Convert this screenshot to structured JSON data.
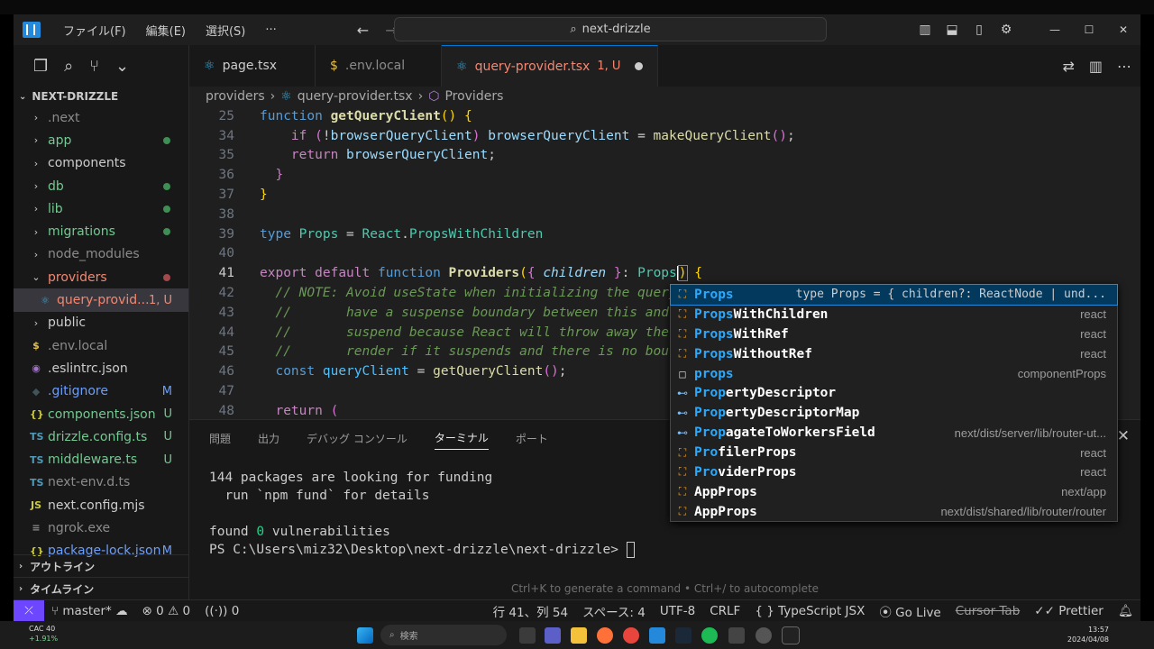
{
  "titlebar": {
    "menus": [
      "ファイル(F)",
      "編集(E)",
      "選択(S)",
      "···"
    ],
    "command_center": "next-drizzle"
  },
  "sidebar": {
    "title": "NEXT-DRIZZLE",
    "items": [
      {
        "label": ".next",
        "type": "folder",
        "color": "#8b8b8b"
      },
      {
        "label": "app",
        "type": "folder",
        "color": "#73c991",
        "dot": "#3f8f54"
      },
      {
        "label": "components",
        "type": "folder",
        "color": "#cccccc"
      },
      {
        "label": "db",
        "type": "folder",
        "color": "#73c991",
        "dot": "#3f8f54"
      },
      {
        "label": "lib",
        "type": "folder",
        "color": "#73c991",
        "dot": "#3f8f54"
      },
      {
        "label": "migrations",
        "type": "folder",
        "color": "#73c991",
        "dot": "#3f8f54"
      },
      {
        "label": "node_modules",
        "type": "folder",
        "color": "#8b8b8b"
      },
      {
        "label": "providers",
        "type": "folder-open",
        "color": "#f48771",
        "dot": "#a1494d"
      },
      {
        "label": "query-provid...",
        "type": "file",
        "color": "#f48771",
        "badge": "1, U",
        "badge_color": "#f48771",
        "icon": "⚛",
        "icon_color": "#3ba7d6"
      },
      {
        "label": "public",
        "type": "folder",
        "color": "#cccccc"
      },
      {
        "label": ".env.local",
        "type": "file",
        "color": "#8b8b8b",
        "icon": "$",
        "icon_color": "#e4c04a"
      },
      {
        "label": ".eslintrc.json",
        "type": "file",
        "color": "#cccccc",
        "icon": "◉",
        "icon_color": "#a074c4"
      },
      {
        "label": ".gitignore",
        "type": "file",
        "color": "#6c9ef8",
        "badge": "M",
        "badge_color": "#6c9ef8",
        "icon": "◆",
        "icon_color": "#41535b"
      },
      {
        "label": "components.json",
        "type": "file",
        "color": "#73c991",
        "badge": "U",
        "badge_color": "#73c991",
        "icon": "{}",
        "icon_color": "#cbcb41"
      },
      {
        "label": "drizzle.config.ts",
        "type": "file",
        "color": "#73c991",
        "badge": "U",
        "badge_color": "#73c991",
        "icon": "TS",
        "icon_color": "#519aba"
      },
      {
        "label": "middleware.ts",
        "type": "file",
        "color": "#73c991",
        "badge": "U",
        "badge_color": "#73c991",
        "icon": "TS",
        "icon_color": "#519aba"
      },
      {
        "label": "next-env.d.ts",
        "type": "file",
        "color": "#8b8b8b",
        "icon": "TS",
        "icon_color": "#519aba"
      },
      {
        "label": "next.config.mjs",
        "type": "file",
        "color": "#cccccc",
        "icon": "JS",
        "icon_color": "#cbcb41"
      },
      {
        "label": "ngrok.exe",
        "type": "file",
        "color": "#8b8b8b",
        "icon": "≡",
        "icon_color": "#8b8b8b"
      },
      {
        "label": "package-lock.json",
        "type": "file",
        "color": "#6c9ef8",
        "badge": "M",
        "badge_color": "#6c9ef8",
        "icon": "{}",
        "icon_color": "#cbcb41"
      }
    ],
    "sections": [
      "アウトライン",
      "タイムライン"
    ]
  },
  "tabs": [
    {
      "label": "page.tsx",
      "icon": "⚛",
      "icon_color": "#3ba7d6",
      "color": "#cccccc",
      "suffix": ""
    },
    {
      "label": ".env.local",
      "icon": "$",
      "icon_color": "#e4c04a",
      "color": "#8b8b8b",
      "suffix": ""
    },
    {
      "label": "query-provider.tsx",
      "icon": "⚛",
      "icon_color": "#3ba7d6",
      "color": "#f48771",
      "suffix": "1, U"
    }
  ],
  "breadcrumb": [
    "providers",
    "query-provider.tsx",
    "Providers"
  ],
  "code": [
    {
      "n": "25",
      "html": "<span style='color:#569cd6'>function</span> <span style='color:#dcdcaa;font-weight:bold'>getQueryClient</span><span style='color:#ffd700'>()</span> <span style='color:#ffd700'>{</span>"
    },
    {
      "n": "34",
      "html": "    <span style='color:#c586c0'>if</span> <span style='color:#da70d6'>(</span>!<span style='color:#9cdcfe'>browserQueryClient</span><span style='color:#da70d6'>)</span> <span style='color:#9cdcfe'>browserQueryClient</span> = <span style='color:#dcdcaa'>makeQueryClient</span><span style='color:#da70d6'>()</span>;"
    },
    {
      "n": "35",
      "html": "    <span style='color:#c586c0'>return</span> <span style='color:#9cdcfe'>browserQueryClient</span>;"
    },
    {
      "n": "36",
      "html": "  <span style='color:#da70d6'>}</span>"
    },
    {
      "n": "37",
      "html": "<span style='color:#ffd700'>}</span>"
    },
    {
      "n": "38",
      "html": ""
    },
    {
      "n": "39",
      "html": "<span style='color:#569cd6'>type</span> <span style='color:#4ec9b0'>Props</span> = <span style='color:#4ec9b0'>React</span>.<span style='color:#4ec9b0'>PropsWithChildren</span>"
    },
    {
      "n": "40",
      "html": ""
    },
    {
      "n": "41",
      "html": "<span style='color:#c586c0'>export</span> <span style='color:#c586c0'>default</span> <span style='color:#569cd6'>function</span> <span style='color:#dcdcaa;font-weight:bold'>Providers</span><span style='color:#ffd700'>(</span><span style='color:#da70d6'>{</span> <span style='color:#9cdcfe;font-style:italic'>children</span> <span style='color:#da70d6'>}</span>: <span style='color:#4ec9b0'>Props</span><span style='border-left:2px solid #fff'></span><span style='color:#ffd700;outline:1px solid #888'>)</span> <span style='color:#ffd700'>{</span>"
    },
    {
      "n": "42",
      "html": "  <span style='color:#6a9955;font-style:italic'>// NOTE: Avoid useState when initializing the query</span>"
    },
    {
      "n": "43",
      "html": "  <span style='color:#6a9955;font-style:italic'>//       have a suspense boundary between this and</span>"
    },
    {
      "n": "44",
      "html": "  <span style='color:#6a9955;font-style:italic'>//       suspend because React will throw away the</span>"
    },
    {
      "n": "45",
      "html": "  <span style='color:#6a9955;font-style:italic'>//       render if it suspends and there is no bou</span>"
    },
    {
      "n": "46",
      "html": "  <span style='color:#569cd6'>const</span> <span style='color:#4fc1ff'>queryClient</span> = <span style='color:#dcdcaa'>getQueryClient</span><span style='color:#da70d6'>()</span>;"
    },
    {
      "n": "47",
      "html": ""
    },
    {
      "n": "48",
      "html": "  <span style='color:#c586c0'>return</span> <span style='color:#da70d6'>(</span>"
    }
  ],
  "current_line": "41",
  "panel": {
    "tabs": [
      "問題",
      "出力",
      "デバッグ コンソール",
      "ターミナル",
      "ポート"
    ],
    "active_tab": "ターミナル",
    "terminal": "144 packages are looking for funding\n  run `npm fund` for details\n\nfound <span style='color:#23d18b'>0</span> vulnerabilities\nPS C:\\Users\\miz32\\Desktop\\next-drizzle\\next-drizzle> <span style='display:inline-block;width:9px;height:18px;border:1px solid #ccc;vertical-align:middle'></span>",
    "hint": "Ctrl+K to generate a command • Ctrl+/ to autocomplete"
  },
  "suggestions": [
    {
      "match": "Props",
      "rest": "",
      "detail": "type Props = { children?: ReactNode | und...",
      "icon": "⛶",
      "icon_color": "#ee9d28",
      "selected": true
    },
    {
      "match": "Props",
      "rest": "WithChildren",
      "detail": "react",
      "icon": "⛶",
      "icon_color": "#ee9d28"
    },
    {
      "match": "Props",
      "rest": "WithRef",
      "detail": "react",
      "icon": "⛶",
      "icon_color": "#ee9d28"
    },
    {
      "match": "Props",
      "rest": "WithoutRef",
      "detail": "react",
      "icon": "⛶",
      "icon_color": "#ee9d28"
    },
    {
      "match": "props",
      "rest": "",
      "detail": "componentProps",
      "icon": "□",
      "icon_color": "#cccccc"
    },
    {
      "match": "Prop",
      "rest": "ertyDescriptor",
      "detail": "",
      "icon": "⊷",
      "icon_color": "#75beff"
    },
    {
      "match": "Prop",
      "rest": "ertyDescriptorMap",
      "detail": "",
      "icon": "⊷",
      "icon_color": "#75beff"
    },
    {
      "match": "Prop",
      "rest": "agateToWorkersField",
      "detail": "next/dist/server/lib/router-ut...",
      "icon": "⊷",
      "icon_color": "#75beff"
    },
    {
      "match": "Pro",
      "rest": "filerProps",
      "detail": "react",
      "icon": "⛶",
      "icon_color": "#ee9d28"
    },
    {
      "match": "Pro",
      "rest": "viderProps",
      "detail": "react",
      "icon": "⛶",
      "icon_color": "#ee9d28"
    },
    {
      "match": "",
      "rest": "AppProps",
      "detail": "next/app",
      "icon": "⛶",
      "icon_color": "#ee9d28"
    },
    {
      "match": "",
      "rest": "AppProps",
      "detail": "next/dist/shared/lib/router/router",
      "icon": "⛶",
      "icon_color": "#ee9d28"
    }
  ],
  "status": {
    "branch": "master*",
    "errors": "0",
    "warnings": "0",
    "ports": "0",
    "position": "行 41、列 54",
    "spaces": "スペース: 4",
    "encoding": "UTF-8",
    "eol": "CRLF",
    "language": "TypeScript JSX",
    "golive": "Go Live",
    "cursor_tab": "Cursor Tab",
    "prettier": "Prettier",
    "accent": "#6c47ff"
  },
  "taskbar": {
    "search": "検索",
    "stock_name": "CAC 40",
    "stock_change": "+1.91%",
    "time": "13:57",
    "date": "2024/04/08"
  }
}
